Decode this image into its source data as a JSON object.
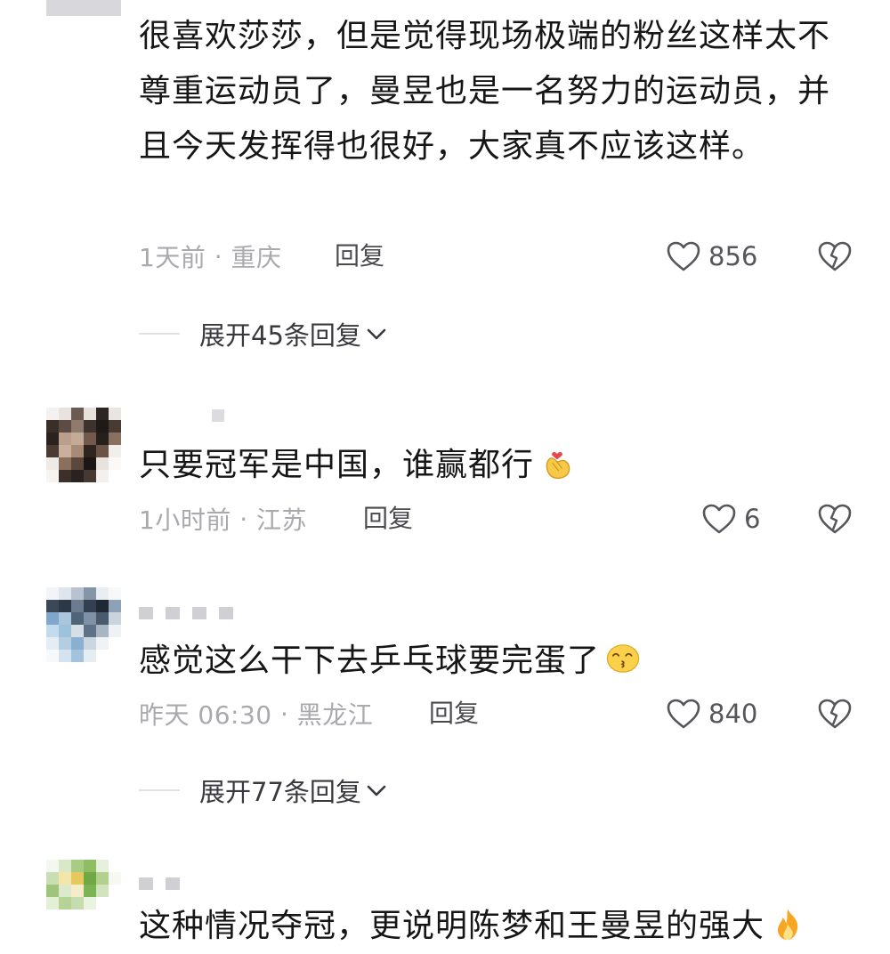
{
  "comments": [
    {
      "text": "很喜欢莎莎，但是觉得现场极端的粉丝这样太不尊重运动员了，曼昱也是一名努力的运动员，并且今天发挥得也很好，大家真不应该这样。",
      "time": "1天前",
      "location": "重庆",
      "reply_label": "回复",
      "likes": "856",
      "expand_label": "展开45条回复"
    },
    {
      "text": "只要冠军是中国，谁赢都行",
      "emoji": "heart-hands-emoji",
      "time": "1小时前",
      "location": "江苏",
      "reply_label": "回复",
      "likes": "6"
    },
    {
      "text": "感觉这么干下去乒乓球要完蛋了",
      "emoji": "kissing-face-emoji",
      "time": "昨天 06:30",
      "location": "黑龙江",
      "reply_label": "回复",
      "likes": "840",
      "expand_label": "展开77条回复"
    },
    {
      "text": "这种情况夺冠，更说明陈梦和王曼昱的强大",
      "emoji": "fire-emoji"
    }
  ],
  "colors": {
    "text": "#161616",
    "meta": "#a9a9ae",
    "icon": "#55555a",
    "divider": "#e2e2e6"
  },
  "icons": {
    "like": "heart-outline-icon",
    "dislike": "broken-heart-icon",
    "expand": "chevron-down-icon"
  }
}
